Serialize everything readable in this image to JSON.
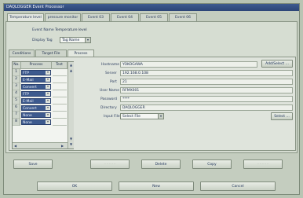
{
  "window": {
    "title": "DAQLOGGER Event Processor"
  },
  "top_tabs": [
    {
      "label": "Temperature level"
    },
    {
      "label": "pressure monitor"
    },
    {
      "label": "Event 03"
    },
    {
      "label": "Event 04"
    },
    {
      "label": "Event 05"
    },
    {
      "label": "Event 06"
    }
  ],
  "event": {
    "name_label": "Event Name",
    "name_value": "Temperature level",
    "display_tag_label": "Display Tag",
    "display_tag_value": "Tag Name"
  },
  "sub_tabs": [
    {
      "label": "Conditions"
    },
    {
      "label": "Target File"
    },
    {
      "label": "Process"
    }
  ],
  "process_table": {
    "headers": [
      "No.",
      "Process",
      "Test"
    ],
    "rows": [
      {
        "no": "1",
        "process": "FTP"
      },
      {
        "no": "2",
        "process": "E-Mail"
      },
      {
        "no": "3",
        "process": "Convert"
      },
      {
        "no": "4",
        "process": "FTP"
      },
      {
        "no": "5",
        "process": "E-Mail"
      },
      {
        "no": "6",
        "process": "Convert"
      },
      {
        "no": "7",
        "process": "None"
      },
      {
        "no": "8",
        "process": "None"
      }
    ]
  },
  "details": {
    "hostname_label": "Hostname",
    "hostname_value": "YOKOGAWA",
    "server_label": "Server",
    "server_value": "192.168.0.108",
    "port_label": "Port",
    "port_value": "21",
    "user_label": "User Name",
    "user_value": "RFMX001",
    "password_label": "Password",
    "password_value": "****",
    "directory_label": "Directory",
    "directory_value": "DAQLOGGER",
    "input_file_label": "Input File",
    "input_file_value": "Select File",
    "add_select_label": "Add/Select ...",
    "select_label": "Select ..."
  },
  "buttons": {
    "save": "Save",
    "btn2": "- - - - -",
    "delete": "Delete",
    "copy": "Copy",
    "btn5": "- - - - -",
    "ok": "OK",
    "new": "New",
    "cancel": "Cancel"
  }
}
